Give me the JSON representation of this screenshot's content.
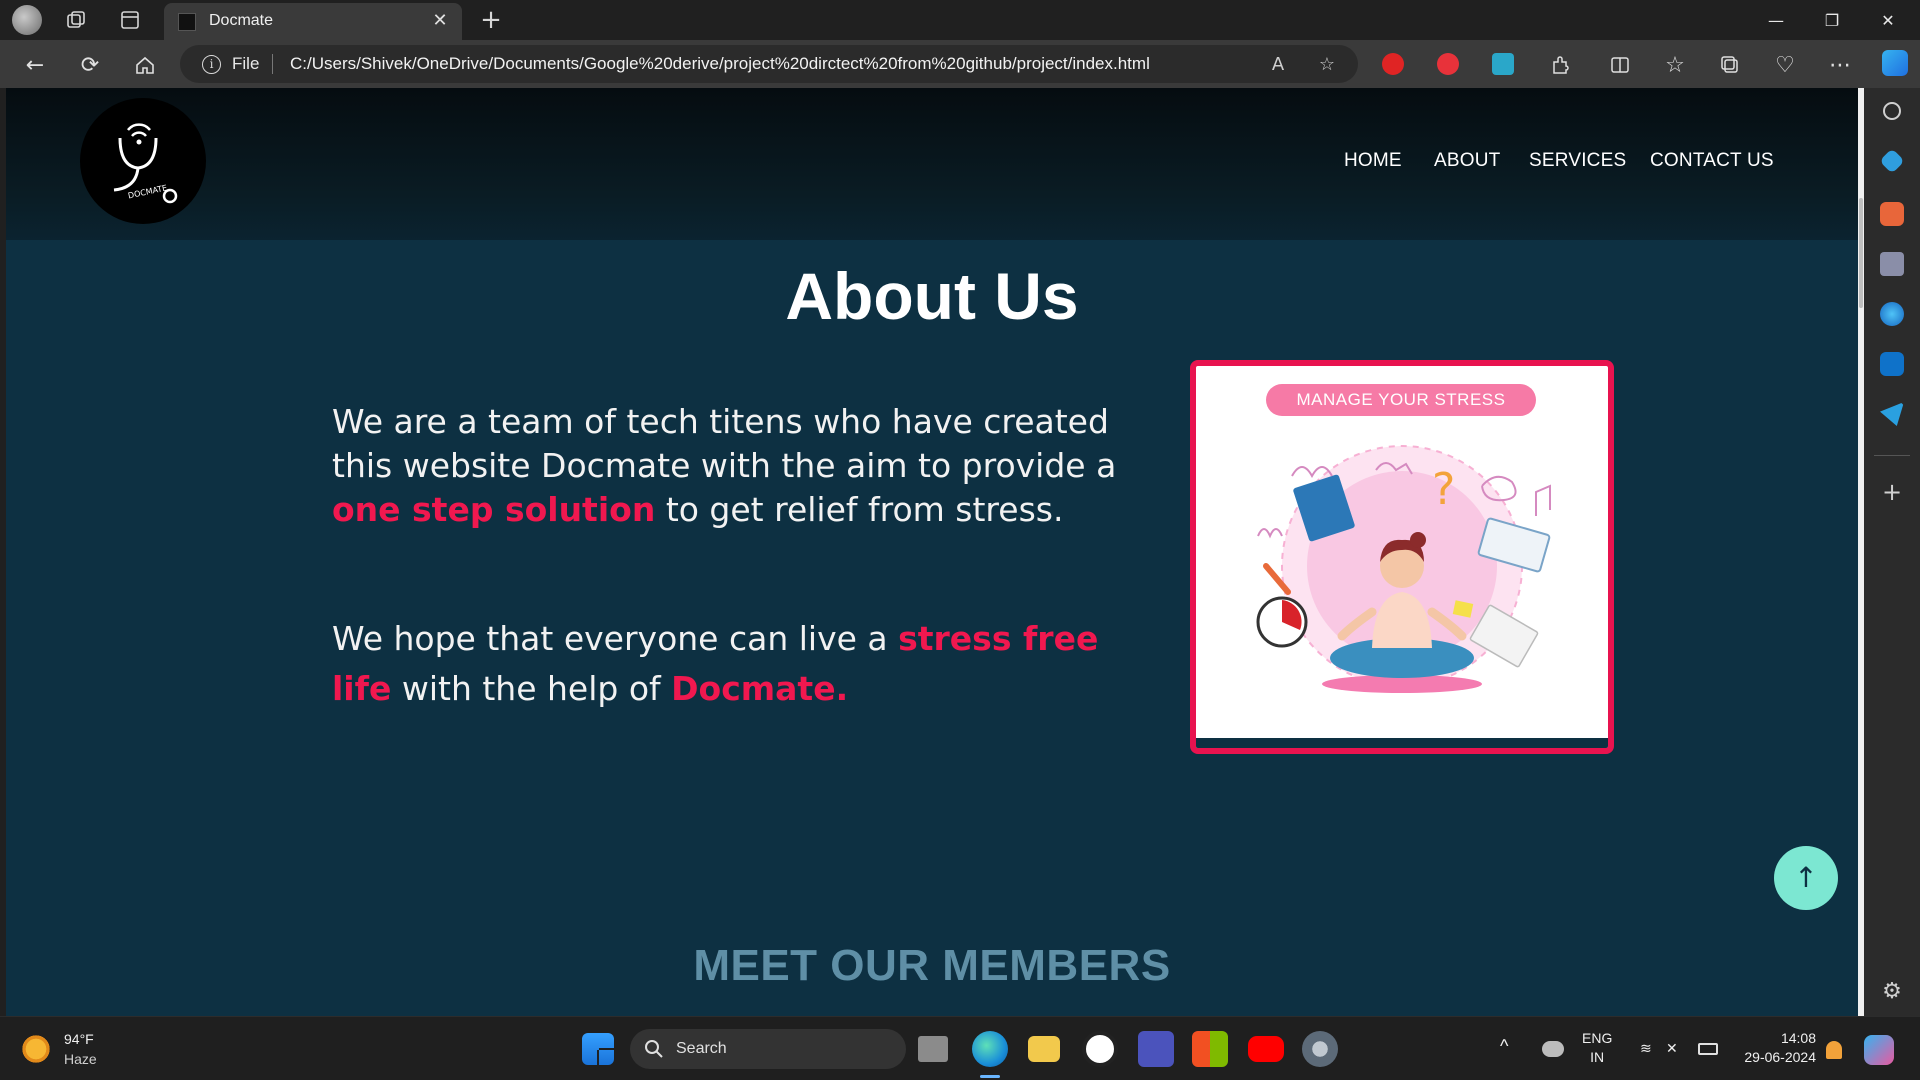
{
  "browser": {
    "tab_title": "Docmate",
    "tab_close": "✕",
    "new_tab": "+",
    "url_scheme": "File",
    "url": "C:/Users/Shivek/OneDrive/Documents/Google%20derive/project%20dirctect%20from%20github/project/index.html",
    "window_controls": {
      "minimize": "—",
      "restore": "❐",
      "close": "✕"
    }
  },
  "site": {
    "nav": [
      {
        "label": "HOME"
      },
      {
        "label": "ABOUT"
      },
      {
        "label": "SERVICES"
      },
      {
        "label": "CONTACT US"
      }
    ],
    "logo_text": "DOCMATE",
    "about": {
      "title": "About Us",
      "para1": {
        "part1": "We are a team of tech titens who have created this website Docmate with the aim to provide a ",
        "highlight": "one step solution",
        "part2": " to get relief from stress."
      },
      "para2": {
        "part1": "We hope that everyone can live a ",
        "highlight1": "stress free life",
        "part2": " with the help of ",
        "highlight2": "Docmate."
      },
      "image_caption": "MANAGE YOUR STRESS"
    },
    "members_title": "MEET OUR MEMBERS",
    "scroll_top_icon": "↑"
  },
  "colors": {
    "accent": "#f0184f",
    "page_bg": "#0d3042",
    "scroll_top_bg": "#7ce7d2",
    "members_title": "#5f8fa6"
  },
  "taskbar": {
    "weather_temp": "94°F",
    "weather_desc": "Haze",
    "search_label": "Search",
    "lang_top": "ENG",
    "lang_bottom": "IN",
    "time": "14:08",
    "date": "29-06-2024"
  }
}
